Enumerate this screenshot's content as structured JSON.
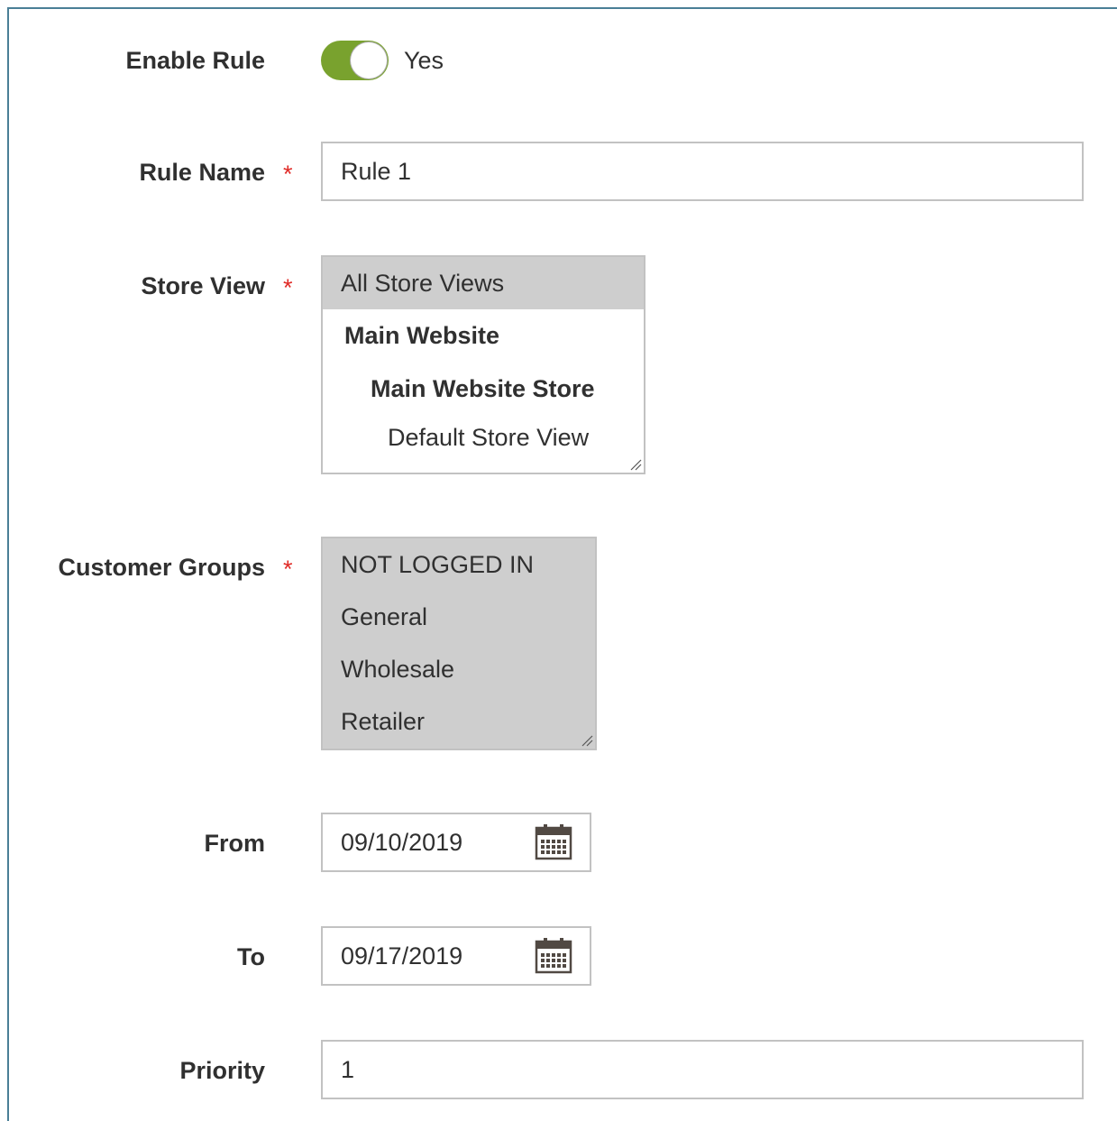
{
  "form": {
    "enable_rule": {
      "label": "Enable Rule",
      "value_text": "Yes",
      "on": true
    },
    "rule_name": {
      "label": "Rule Name",
      "required": "*",
      "value": "Rule 1"
    },
    "store_view": {
      "label": "Store View",
      "required": "*",
      "options": [
        {
          "text": "All Store Views",
          "selected": true
        },
        {
          "text": "Main Website",
          "group": true
        },
        {
          "text": "Main Website Store",
          "group": true
        },
        {
          "text": "Default Store View"
        }
      ]
    },
    "customer_groups": {
      "label": "Customer Groups",
      "required": "*",
      "options": [
        {
          "text": "NOT LOGGED IN",
          "selected": true
        },
        {
          "text": "General",
          "selected": true
        },
        {
          "text": "Wholesale",
          "selected": true
        },
        {
          "text": "Retailer",
          "selected": true
        }
      ]
    },
    "from": {
      "label": "From",
      "value": "09/10/2019"
    },
    "to": {
      "label": "To",
      "value": "09/17/2019"
    },
    "priority": {
      "label": "Priority",
      "value": "1"
    }
  },
  "colors": {
    "toggle_on": "#79a22e",
    "required": "#e02b27",
    "selected_option": "#cecece",
    "frame_border": "#4a7f96"
  },
  "icons": {
    "calendar": "calendar-icon",
    "resize": "resize-grip-icon"
  }
}
